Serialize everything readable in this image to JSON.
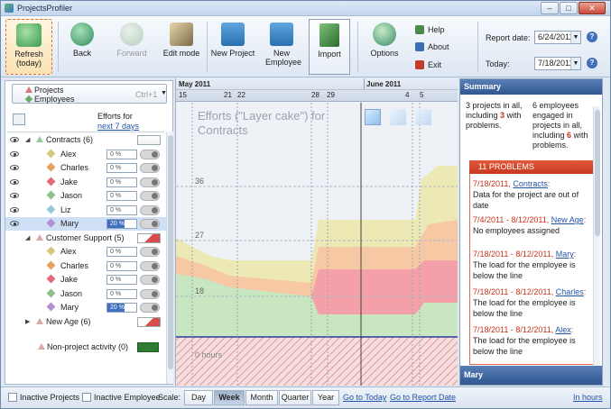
{
  "window": {
    "title": "ProjectsProfiler"
  },
  "toolbar": {
    "refresh": "Refresh\n(today)",
    "back": "Back",
    "forward": "Forward",
    "edit_mode": "Edit mode",
    "new_project": "New Project",
    "new_employee": "New Employee",
    "import": "Import",
    "options": "Options",
    "help": "Help",
    "about": "About",
    "exit": "Exit",
    "report_date_label": "Report date:",
    "report_date": "6/24/2011",
    "today_label": "Today:",
    "today": "7/18/2011"
  },
  "left": {
    "mode_projects": "Projects",
    "mode_employees": "Employees",
    "mode_shortcut": "Ctrl+1",
    "efforts_for": "Efforts for",
    "next_days": "next 7 days",
    "groups": [
      {
        "name": "Contracts (6)",
        "members": [
          {
            "name": "Alex",
            "pct": "0 %",
            "color": "#d4c87a"
          },
          {
            "name": "Charles",
            "pct": "0 %",
            "color": "#e8a060"
          },
          {
            "name": "Jake",
            "pct": "0 %",
            "color": "#e06a78"
          },
          {
            "name": "Jason",
            "pct": "0 %",
            "color": "#8cc08c"
          },
          {
            "name": "Liz",
            "pct": "0 %",
            "color": "#98c8d8"
          },
          {
            "name": "Mary",
            "pct": "20 %",
            "color": "#b490d0"
          }
        ]
      },
      {
        "name": "Customer Support (5)",
        "members": [
          {
            "name": "Alex",
            "pct": "0 %",
            "color": "#d4c87a"
          },
          {
            "name": "Charles",
            "pct": "0 %",
            "color": "#e8a060"
          },
          {
            "name": "Jake",
            "pct": "0 %",
            "color": "#e06a78"
          },
          {
            "name": "Jason",
            "pct": "0 %",
            "color": "#8cc08c"
          },
          {
            "name": "Mary",
            "pct": "20 %",
            "color": "#b490d0"
          }
        ]
      },
      {
        "name": "New Age (6)",
        "members": []
      }
    ],
    "nonproject": "Non-project activity (0)"
  },
  "chart": {
    "month1": "May 2011",
    "month2": "June 2011",
    "days": [
      "15",
      "21",
      "22",
      "28",
      "29",
      "4",
      "5"
    ],
    "title": "Efforts (\"Layer cake\") for Contracts",
    "ticks": [
      "36",
      "27",
      "18",
      "0 hours"
    ]
  },
  "summary": {
    "header": "Summary",
    "text1": "3 projects in all, including ",
    "n1": "3",
    "text1b": " with problems.",
    "text2": "6 employees engaged in projects in all, including ",
    "n2": "6",
    "text2b": " with problems.",
    "problems_header": "11 PROBLEMS",
    "problems": [
      {
        "date": "7/18/2011, ",
        "link": "Contracts",
        "desc": "Data for the project are out of date"
      },
      {
        "date": "7/4/2011 - 8/12/2011, ",
        "link": "New Age",
        "desc": "No employees assigned"
      },
      {
        "date": "7/18/2011 - 8/12/2011, ",
        "link": "Mary",
        "desc": "The load for the employee is below the line"
      },
      {
        "date": "7/18/2011 - 8/12/2011, ",
        "link": "Charles",
        "desc": "The load for the employee is below the line"
      },
      {
        "date": "7/18/2011 - 8/12/2011, ",
        "link": "Alex",
        "desc": "The load for the employee is below the line"
      }
    ],
    "footer": "Mary"
  },
  "status": {
    "inactive_projects": "Inactive Projects",
    "inactive_employee": "Inactive Employee",
    "scale": "Scale:",
    "day": "Day",
    "week": "Week",
    "month": "Month",
    "quarter": "Quarter",
    "year": "Year",
    "goto_today": "Go to Today",
    "goto_report": "Go to Report Date",
    "in_hours": "In hours"
  }
}
